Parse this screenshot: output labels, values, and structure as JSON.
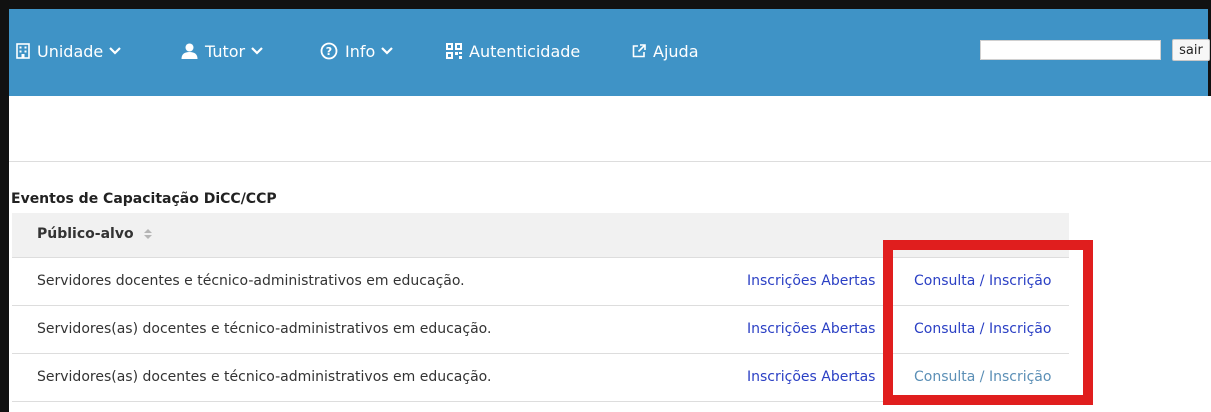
{
  "navbar": {
    "bg_color": "#3f93c6",
    "items": [
      {
        "label": "Unidade",
        "icon": "building-icon",
        "dropdown": true
      },
      {
        "label": "Tutor",
        "icon": "user-icon",
        "dropdown": true
      },
      {
        "label": "Info",
        "icon": "question-circle-icon",
        "dropdown": true
      },
      {
        "label": "Autenticidade",
        "icon": "qrcode-icon",
        "dropdown": false
      },
      {
        "label": "Ajuda",
        "icon": "external-link-icon",
        "dropdown": false
      }
    ],
    "search": {
      "value": "",
      "placeholder": ""
    },
    "logout_label": "sair"
  },
  "section": {
    "title": "Eventos de Capacitação DiCC/CCP"
  },
  "table": {
    "column_header": "Público-alvo",
    "rows": [
      {
        "publico": "Servidores docentes e técnico-administrativos em educação.",
        "status": "Inscrições Abertas",
        "action": "Consulta / Inscrição"
      },
      {
        "publico": "Servidores(as) docentes e técnico-administrativos em educação.",
        "status": "Inscrições Abertas",
        "action": "Consulta / Inscrição"
      },
      {
        "publico": "Servidores(as) docentes e técnico-administrativos em educação.",
        "status": "Inscrições Abertas",
        "action": "Consulta / Inscrição"
      }
    ]
  },
  "colors": {
    "link": "#2a3fc4",
    "highlight": "#e01e1e"
  }
}
